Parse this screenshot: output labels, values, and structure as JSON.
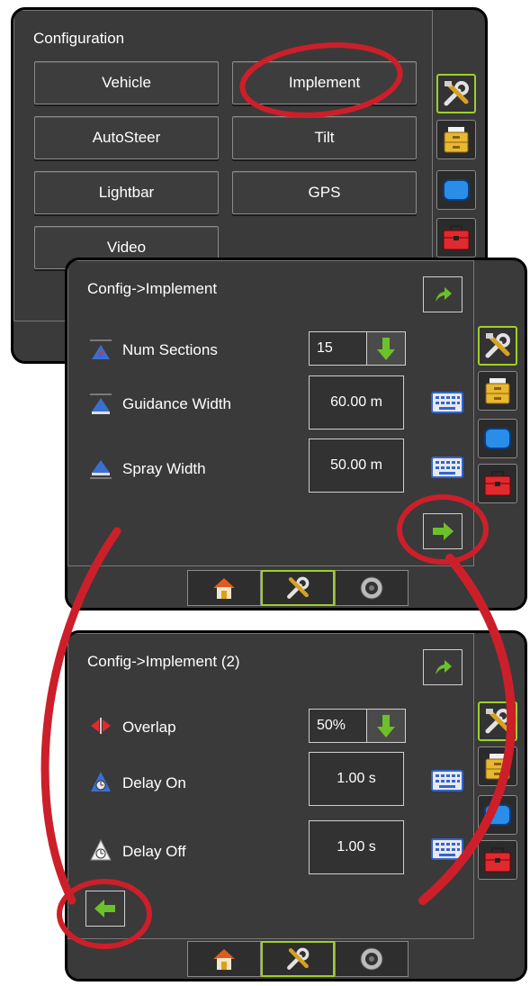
{
  "screen1": {
    "title": "Configuration",
    "buttons": [
      "Vehicle",
      "Implement",
      "AutoSteer",
      "Tilt",
      "Lightbar",
      "GPS",
      "Video"
    ]
  },
  "sidebar": {
    "tabs": [
      {
        "icon": "tools-icon",
        "active": true
      },
      {
        "icon": "file-cabinet-icon",
        "active": false
      },
      {
        "icon": "display-icon",
        "active": false
      },
      {
        "icon": "toolbox-icon",
        "active": false
      }
    ]
  },
  "screen2": {
    "title": "Config->Implement",
    "rows": [
      {
        "label": "Num Sections",
        "value": "15",
        "type": "dropdown",
        "icon": "num-sections-icon"
      },
      {
        "label": "Guidance Width",
        "value": "60.00 m",
        "type": "keyboard",
        "icon": "guidance-width-icon"
      },
      {
        "label": "Spray Width",
        "value": "50.00 m",
        "type": "keyboard",
        "icon": "spray-width-icon"
      }
    ]
  },
  "screen3": {
    "title": "Config->Implement (2)",
    "rows": [
      {
        "label": "Overlap",
        "value": "50%",
        "type": "dropdown",
        "icon": "overlap-icon"
      },
      {
        "label": "Delay On",
        "value": "1.00 s",
        "type": "keyboard",
        "icon": "delay-on-icon"
      },
      {
        "label": "Delay Off",
        "value": "1.00 s",
        "type": "keyboard",
        "icon": "delay-off-icon"
      }
    ]
  },
  "bottom_tabs": [
    {
      "icon": "home-icon",
      "active": false
    },
    {
      "icon": "tools-icon",
      "active": true
    },
    {
      "icon": "camera-icon",
      "active": false
    }
  ],
  "colors": {
    "accent_green": "#9ecf2a",
    "annotation_red": "#cc1f2a",
    "screen_bg": "#3a3a3a"
  }
}
